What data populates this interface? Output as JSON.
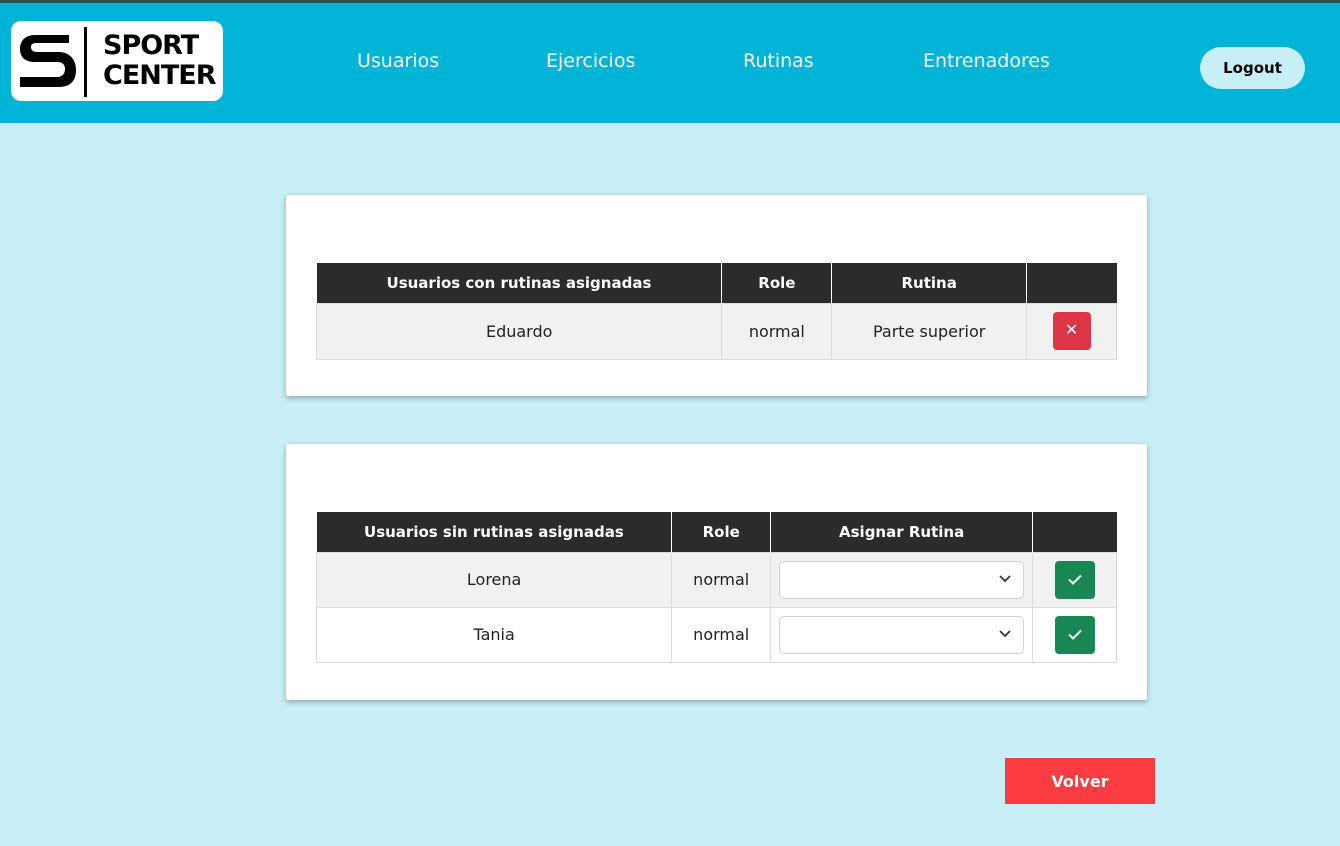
{
  "brand": {
    "logo_text": "SPORT\nCENTER",
    "navbar_color": "#00b4d8",
    "background_color": "#c8eff6"
  },
  "nav": {
    "items": [
      {
        "label": "Usuarios"
      },
      {
        "label": "Ejercicios"
      },
      {
        "label": "Rutinas"
      },
      {
        "label": "Entrenadores"
      }
    ],
    "logout_label": "Logout"
  },
  "assigned": {
    "headers": [
      "Usuarios con rutinas asignadas",
      "Role",
      "Rutina",
      ""
    ],
    "rows": [
      {
        "name": "Eduardo",
        "role": "normal",
        "rutina": "Parte superior",
        "action_icon": "close-icon"
      }
    ]
  },
  "unassigned": {
    "headers": [
      "Usuarios sin rutinas asignadas",
      "Role",
      "Asignar Rutina",
      ""
    ],
    "rows": [
      {
        "name": "Lorena",
        "role": "normal",
        "selected": "",
        "action_icon": "check-icon"
      },
      {
        "name": "Tania",
        "role": "normal",
        "selected": "",
        "action_icon": "check-icon"
      }
    ]
  },
  "volver_label": "Volver"
}
